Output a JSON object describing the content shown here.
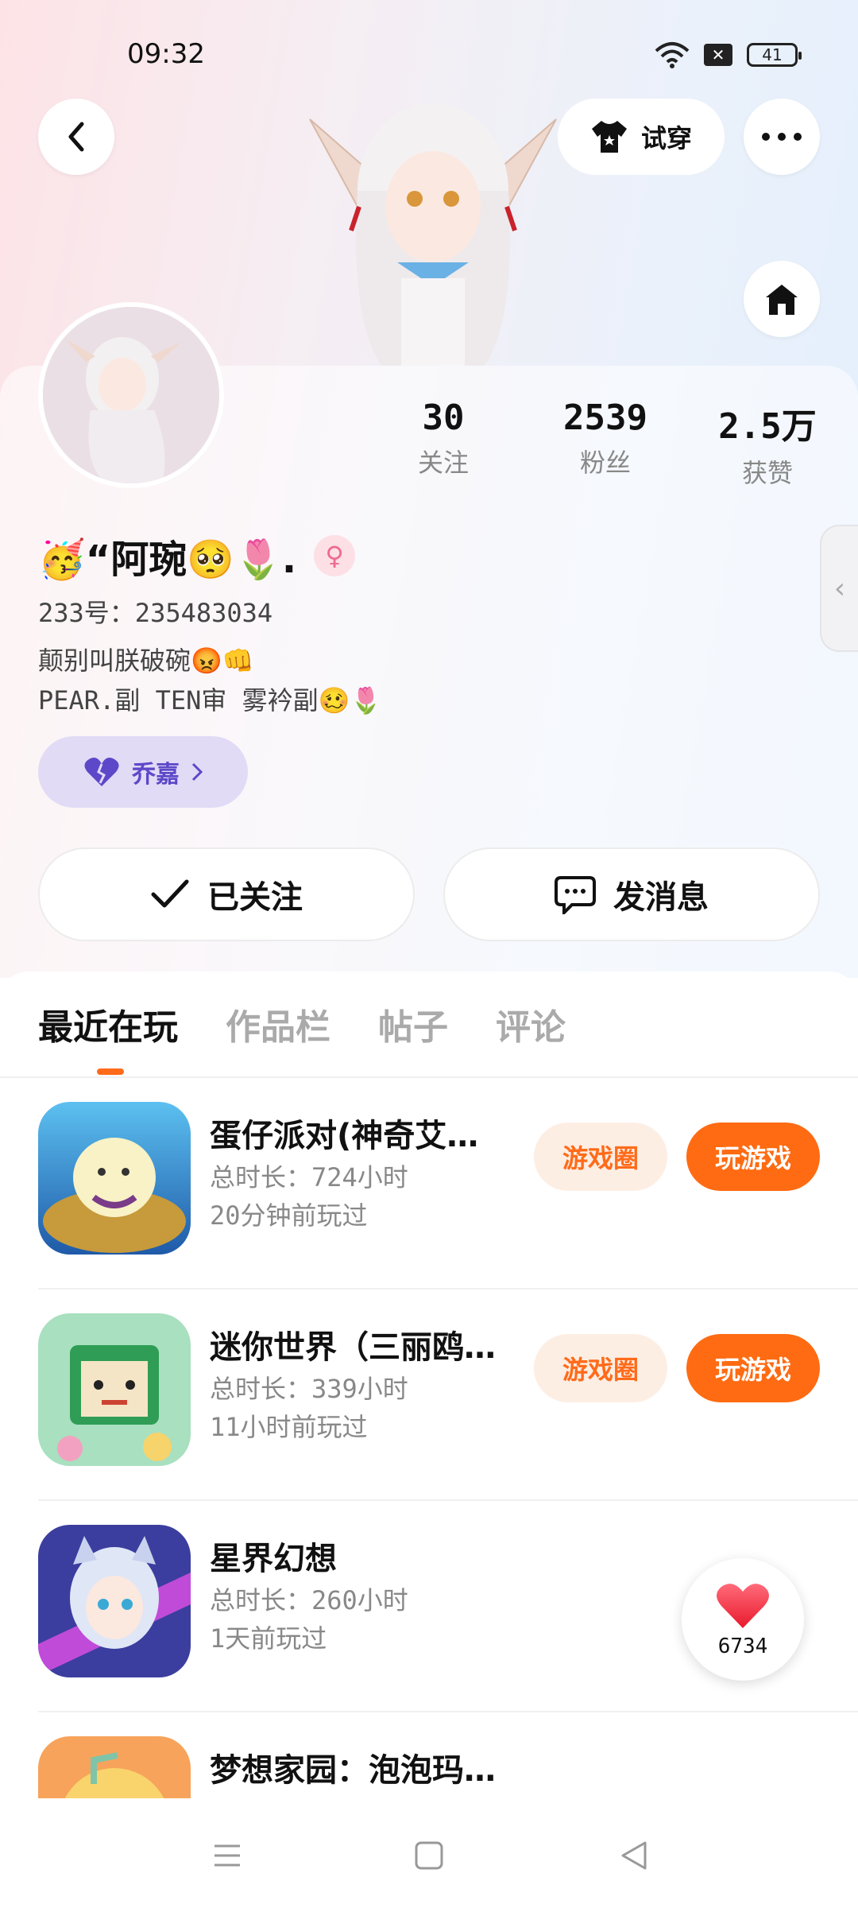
{
  "status_bar": {
    "time": "09:32",
    "battery": "41",
    "icons": [
      "wifi-icon",
      "sim-off-icon",
      "battery-icon"
    ]
  },
  "header": {
    "back_icon": "back-chevron-icon",
    "try_on_label": "试穿",
    "more_icon": "more-dots-icon",
    "home_icon": "home-icon"
  },
  "profile": {
    "stats": [
      {
        "value": "30",
        "label": "关注"
      },
      {
        "value": "2539",
        "label": "粉丝"
      },
      {
        "value": "2.5万",
        "label": "获赞"
      }
    ],
    "name": "🥳“阿琬🥺🌷.",
    "gender": "♀",
    "uid": "233号：235483034",
    "bio_lines": [
      "颠别叫朕破碗😡👊",
      "PEAR.副 TEN审 雾衿副🥴🌷"
    ],
    "pair_label": "乔嘉",
    "follow_label": "已关注",
    "message_label": "发消息"
  },
  "tabs": [
    "最近在玩",
    "作品栏",
    "帖子",
    "评论"
  ],
  "active_tab": 0,
  "games": [
    {
      "title": "蛋仔派对(神奇艾…",
      "total": "总时长：724小时",
      "last": "20分钟前玩过",
      "circle_label": "游戏圈",
      "play_label": "玩游戏"
    },
    {
      "title": "迷你世界（三丽鸥…",
      "total": "总时长：339小时",
      "last": "11小时前玩过",
      "circle_label": "游戏圈",
      "play_label": "玩游戏"
    },
    {
      "title": "星界幻想",
      "total": "总时长：260小时",
      "last": "1天前玩过",
      "circle_label": "",
      "play_label": ""
    },
    {
      "title": "梦想家园：泡泡玛…",
      "total": "",
      "last": "",
      "circle_label": "",
      "play_label": ""
    }
  ],
  "like_fab": {
    "count": "6734",
    "icon": "heart-icon"
  },
  "nav": [
    "menu-icon",
    "home-square-icon",
    "back-triangle-icon"
  ],
  "colors": {
    "accent": "#ff6b12",
    "pair_chip": "#e2dbf6",
    "pair_text": "#5d48c9"
  }
}
